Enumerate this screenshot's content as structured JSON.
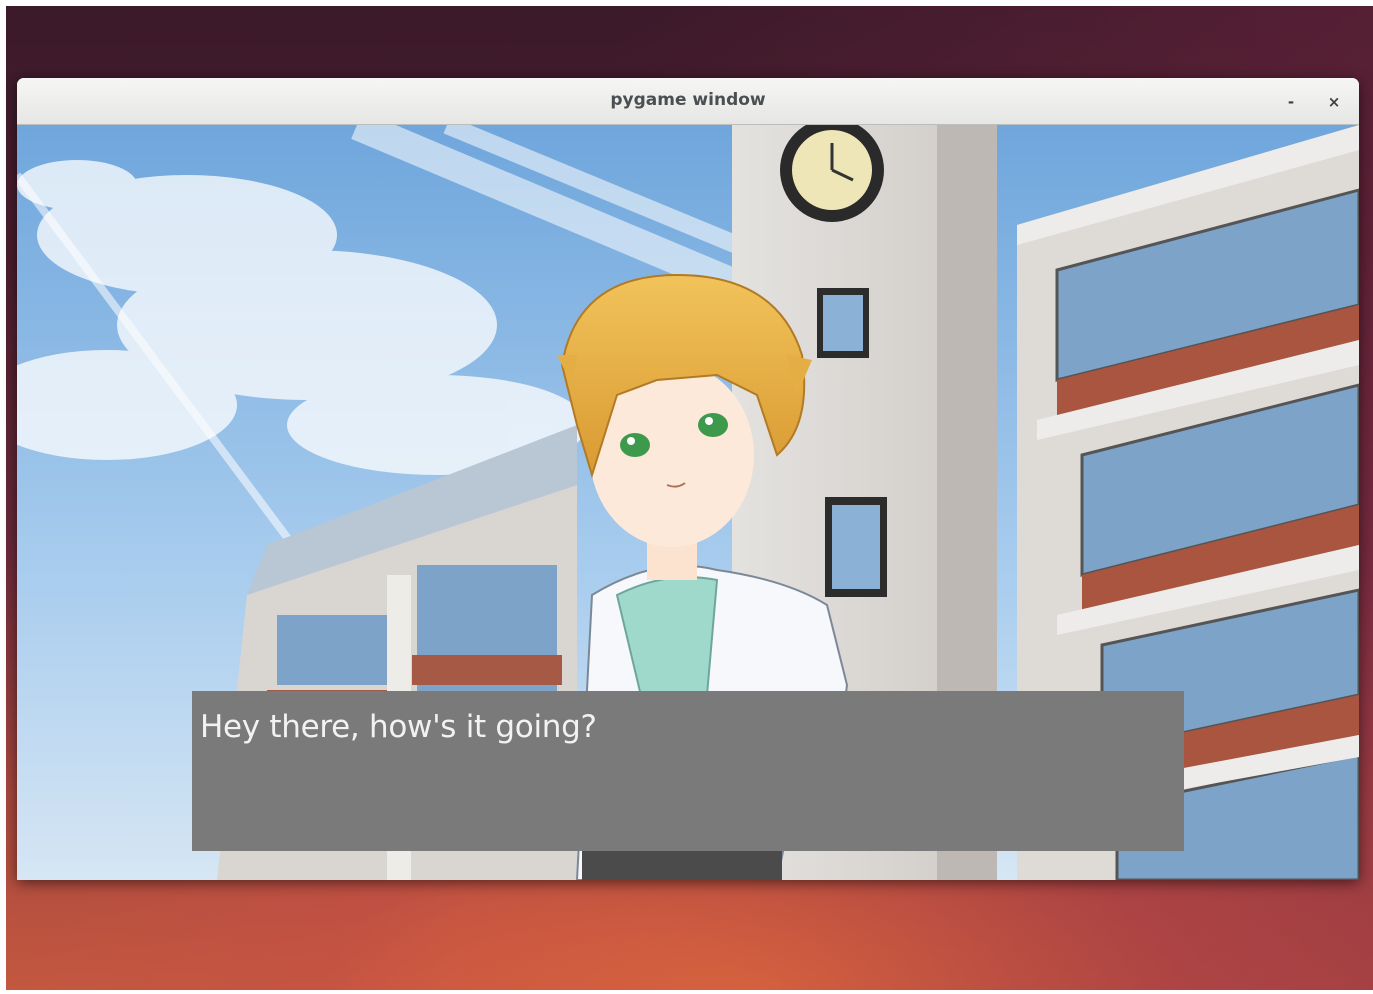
{
  "window": {
    "title": "pygame window",
    "minimize_glyph": "-",
    "close_glyph": "×"
  },
  "game": {
    "background": "school-building-under-blue-sky",
    "character": "blonde-boy-with-green-eyes-white-hoodie",
    "dialog_text": "Hey there, how's it going?"
  },
  "colors": {
    "dialog_bg": "#7a7a7a",
    "dialog_text": "#f2f2f2",
    "sky": "#8fbde6"
  }
}
